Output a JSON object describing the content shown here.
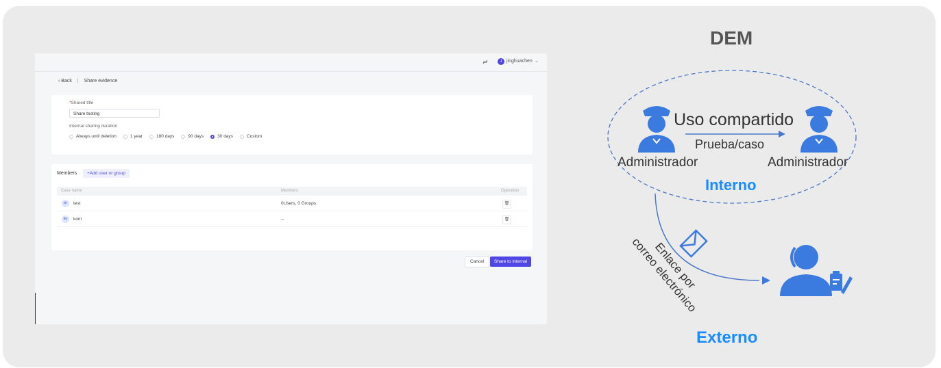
{
  "screenshot": {
    "topbar": {
      "lang_icon": "⇄",
      "avatar_letter": "J",
      "user": "jinghuachen",
      "chevron": "⌄"
    },
    "breadcrumb": {
      "back": "‹ Back",
      "sep": "|",
      "page": "Share evidence"
    },
    "form": {
      "title_label": "Shared title",
      "title_required_mark": "*",
      "title_value": "Share testing",
      "duration_label": "Internal sharing duration",
      "duration_options": [
        "Always until deletion",
        "1 year",
        "180 days",
        "90 days",
        "30 days",
        "Custom"
      ],
      "duration_selected": "30 days"
    },
    "members": {
      "tab": "Members",
      "add_button": "+Add user or group",
      "columns": [
        "Case name",
        "Members",
        "Operation"
      ],
      "rows": [
        {
          "avatar": "te",
          "name": "test",
          "members": "0Users, 0 Groups",
          "op_icon": "trash-icon"
        },
        {
          "avatar": "ko",
          "name": "kom",
          "members": "--",
          "op_icon": "trash-icon"
        }
      ]
    },
    "actions": {
      "cancel": "Cancel",
      "share": "Share to Internal"
    },
    "accent": "#4f46e5"
  },
  "diagram": {
    "title": "DEM",
    "left_admin": "Administrador",
    "right_admin": "Administrador",
    "share_label": "Uso compartido",
    "share_sub": "Prueba/caso",
    "internal": "Interno",
    "email_label_1": "Enlace por",
    "email_label_2": "correo electrónico",
    "external": "Externo",
    "colors": {
      "accent_blue": "#1a8cff",
      "icon_blue": "#3b7be0",
      "dashed": "#4a78c8"
    }
  }
}
